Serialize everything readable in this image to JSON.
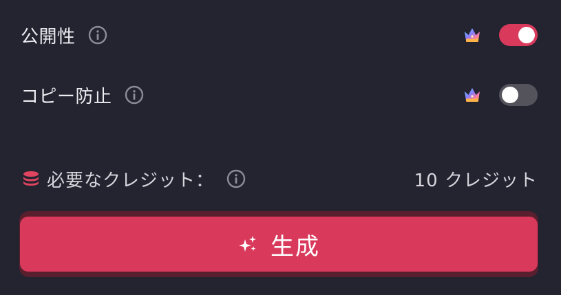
{
  "settings": {
    "public": {
      "label": "公開性",
      "info_icon": "info-icon",
      "premium_icon": "crown-icon",
      "enabled": true
    },
    "copy_protection": {
      "label": "コピー防止",
      "info_icon": "info-icon",
      "premium_icon": "crown-icon",
      "enabled": false
    }
  },
  "credits": {
    "icon": "coins-icon",
    "label": "必要なクレジット：",
    "value": "10 クレジット"
  },
  "generate": {
    "icon": "sparkle-icon",
    "label": "生成"
  },
  "colors": {
    "background": "#242330",
    "accent": "#d93a5c",
    "toggle_off": "#54535c",
    "text": "#ececf1"
  }
}
